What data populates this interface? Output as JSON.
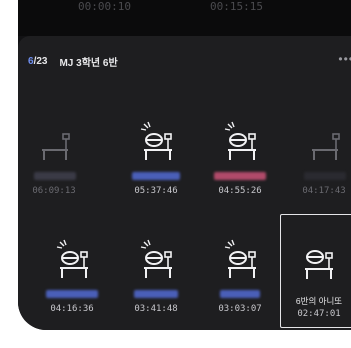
{
  "status_bar": {
    "time_left": "00:00:10",
    "time_right": "00:15:15"
  },
  "header": {
    "current": "6",
    "separator": "/",
    "total": "23",
    "class_name": "MJ 3학년 6반",
    "more": "•••"
  },
  "seats": [
    {
      "state": "empty",
      "time": "06:09:13",
      "blur_color": "#3a3a46"
    },
    {
      "state": "active",
      "time": "05:37:46",
      "blur_color": "#4a5fb8"
    },
    {
      "state": "active",
      "time": "04:55:26",
      "blur_color": "#b04a6a"
    },
    {
      "state": "empty",
      "time": "04:17:43",
      "blur_color": "#2a2a30"
    },
    {
      "state": "active",
      "time": "04:16:36",
      "blur_color": "#4a5fb8"
    },
    {
      "state": "active",
      "time": "03:41:48",
      "blur_color": "#4a5fb8"
    },
    {
      "state": "active",
      "time": "03:03:07",
      "blur_color": "#4a5fb8"
    },
    {
      "state": "active",
      "time": "02:47:01",
      "label": "6반의 아니또",
      "selected": true
    }
  ],
  "colors": {
    "accent": "#6f8ff0",
    "active_line": "#f2f2f4",
    "empty_line": "#6a6a70"
  }
}
